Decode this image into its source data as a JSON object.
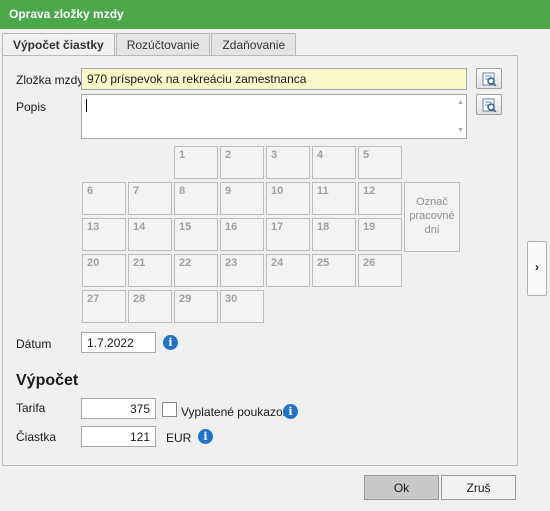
{
  "window": {
    "title": "Oprava zložky mzdy"
  },
  "tabs": [
    {
      "label": "Výpočet čiastky"
    },
    {
      "label": "Rozúčtovanie"
    },
    {
      "label": "Zdaňovanie"
    }
  ],
  "form": {
    "zlozka_label": "Zložka mzdy",
    "zlozka_value": "970  príspevok na rekreáciu zamestnanca",
    "popis_label": "Popis",
    "popis_value": "",
    "datum_label": "Dátum",
    "datum_value": "1.7.2022"
  },
  "calendar": {
    "days": [
      "1",
      "2",
      "3",
      "4",
      "5",
      "6",
      "7",
      "8",
      "9",
      "10",
      "11",
      "12",
      "13",
      "14",
      "15",
      "16",
      "17",
      "18",
      "19",
      "20",
      "21",
      "22",
      "23",
      "24",
      "25",
      "26",
      "27",
      "28",
      "29",
      "30"
    ],
    "mark_button": [
      "Označ",
      "pracovné",
      "dni"
    ]
  },
  "vypocet": {
    "title": "Výpočet",
    "tarifa_label": "Tarifa",
    "tarifa_value": "375",
    "checkbox_label": "Vyplatené poukazom",
    "ciastka_label": "Čiastka",
    "ciastka_value": "121",
    "currency": "EUR"
  },
  "icons": {
    "info": "i",
    "side_arrow": "›"
  },
  "buttons": {
    "ok": "Ok",
    "cancel": "Zruš"
  },
  "colors": {
    "titlebar": "#4aa84a",
    "info": "#1f74c8",
    "highlight_field": "#fafac8"
  }
}
